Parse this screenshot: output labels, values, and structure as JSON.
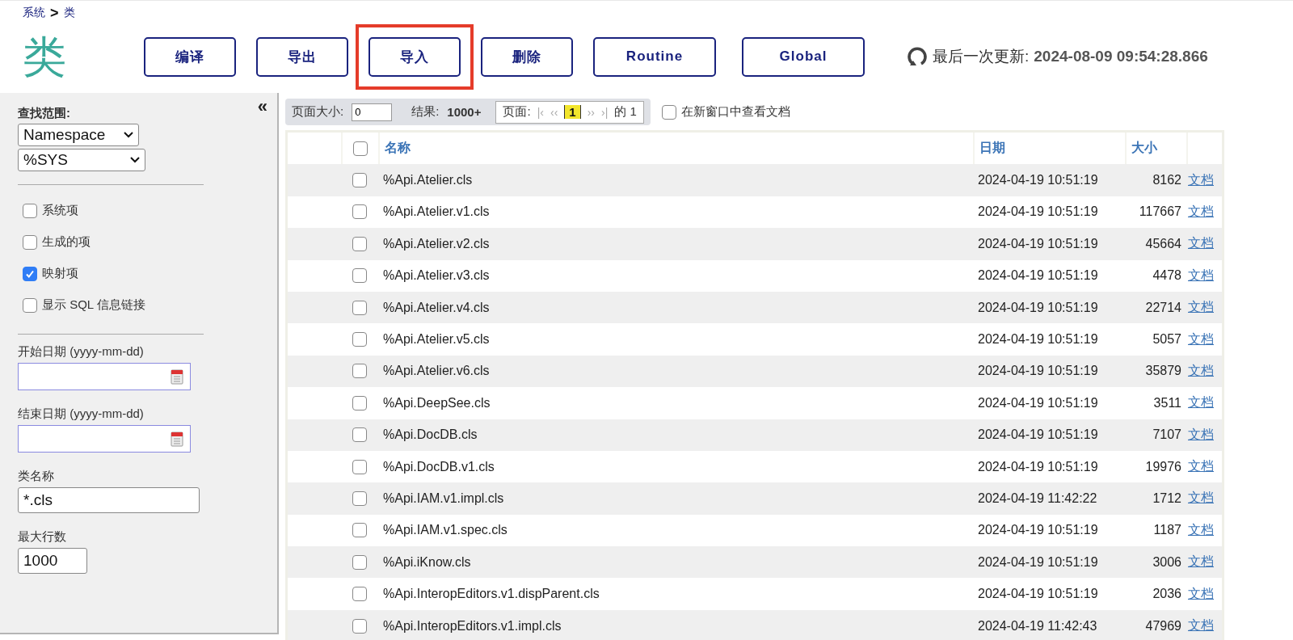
{
  "breadcrumb": {
    "items": [
      "系统",
      "类"
    ],
    "separator": ">"
  },
  "title": "类",
  "buttons": [
    {
      "label": "编译",
      "highlighted": false
    },
    {
      "label": "导出",
      "highlighted": false
    },
    {
      "label": "导入",
      "highlighted": true
    },
    {
      "label": "删除",
      "highlighted": false
    },
    {
      "label": "Routine",
      "highlighted": false
    },
    {
      "label": "Global",
      "highlighted": false
    }
  ],
  "last_update": {
    "label": "最后一次更新:",
    "value": "2024-08-09 09:54:28.866"
  },
  "sidebar": {
    "collapse": "«",
    "scope_label": "查找范围:",
    "scope_type": "Namespace",
    "scope_value": "%SYS",
    "options": [
      {
        "label": "系统项",
        "checked": false
      },
      {
        "label": "生成的项",
        "checked": false
      },
      {
        "label": "映射项",
        "checked": true
      },
      {
        "label": "显示 SQL 信息链接",
        "checked": false
      }
    ],
    "start_date": {
      "label": "开始日期 (yyyy-mm-dd)"
    },
    "end_date": {
      "label": "结束日期 (yyyy-mm-dd)"
    },
    "class_name": {
      "label": "类名称",
      "value": "*.cls"
    },
    "max_rows": {
      "label": "最大行数",
      "value": "1000"
    }
  },
  "toolbar": {
    "page_size_label": "页面大小:",
    "page_size": "0",
    "results_label": "结果:",
    "results": "1000+",
    "pager_label": "页面:",
    "pager_prev": [
      "|‹",
      "‹‹"
    ],
    "current_page": "1",
    "pager_next": [
      "››",
      "›|"
    ],
    "page_of": "的 1",
    "new_window": {
      "label": "在新窗口中查看文档",
      "checked": false
    }
  },
  "table": {
    "columns": [
      "名称",
      "日期",
      "大小"
    ],
    "select_all": false,
    "rows": [
      {
        "name": "%Api.Atelier.cls",
        "date": "2024-04-19 10:51:19",
        "size": "8162",
        "link": "文档",
        "checked": false
      },
      {
        "name": "%Api.Atelier.v1.cls",
        "date": "2024-04-19 10:51:19",
        "size": "117667",
        "link": "文档",
        "checked": false
      },
      {
        "name": "%Api.Atelier.v2.cls",
        "date": "2024-04-19 10:51:19",
        "size": "45664",
        "link": "文档",
        "checked": false
      },
      {
        "name": "%Api.Atelier.v3.cls",
        "date": "2024-04-19 10:51:19",
        "size": "4478",
        "link": "文档",
        "checked": false
      },
      {
        "name": "%Api.Atelier.v4.cls",
        "date": "2024-04-19 10:51:19",
        "size": "22714",
        "link": "文档",
        "checked": false
      },
      {
        "name": "%Api.Atelier.v5.cls",
        "date": "2024-04-19 10:51:19",
        "size": "5057",
        "link": "文档",
        "checked": false
      },
      {
        "name": "%Api.Atelier.v6.cls",
        "date": "2024-04-19 10:51:19",
        "size": "35879",
        "link": "文档",
        "checked": false
      },
      {
        "name": "%Api.DeepSee.cls",
        "date": "2024-04-19 10:51:19",
        "size": "3511",
        "link": "文档",
        "checked": false
      },
      {
        "name": "%Api.DocDB.cls",
        "date": "2024-04-19 10:51:19",
        "size": "7107",
        "link": "文档",
        "checked": false
      },
      {
        "name": "%Api.DocDB.v1.cls",
        "date": "2024-04-19 10:51:19",
        "size": "19976",
        "link": "文档",
        "checked": false
      },
      {
        "name": "%Api.IAM.v1.impl.cls",
        "date": "2024-04-19 11:42:22",
        "size": "1712",
        "link": "文档",
        "checked": false
      },
      {
        "name": "%Api.IAM.v1.spec.cls",
        "date": "2024-04-19 10:51:19",
        "size": "1187",
        "link": "文档",
        "checked": false
      },
      {
        "name": "%Api.iKnow.cls",
        "date": "2024-04-19 10:51:19",
        "size": "3006",
        "link": "文档",
        "checked": false
      },
      {
        "name": "%Api.InteropEditors.v1.dispParent.cls",
        "date": "2024-04-19 10:51:19",
        "size": "2036",
        "link": "文档",
        "checked": false
      },
      {
        "name": "%Api.InteropEditors.v1.impl.cls",
        "date": "2024-04-19 11:42:43",
        "size": "47969",
        "link": "文档",
        "checked": false
      }
    ]
  }
}
